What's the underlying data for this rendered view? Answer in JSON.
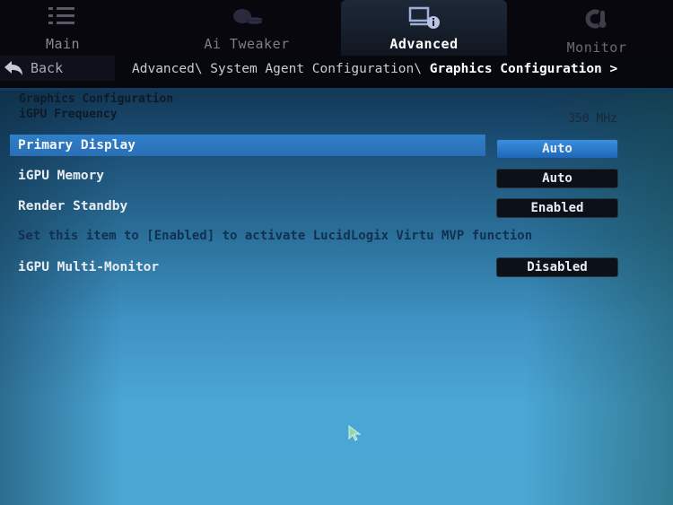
{
  "tabs": [
    {
      "label": "Main",
      "icon": "list-icon",
      "active": false
    },
    {
      "label": "Ai Tweaker",
      "icon": "tweaker-icon",
      "active": false
    },
    {
      "label": "Advanced",
      "icon": "advanced-info-icon",
      "active": true
    },
    {
      "label": "Monitor",
      "icon": "thermometer-icon",
      "active": false
    }
  ],
  "nav": {
    "back_label": "Back",
    "breadcrumb_path": "Advanced\\ System Agent Configuration\\ ",
    "breadcrumb_current": "Graphics Configuration >"
  },
  "section": {
    "title": "Graphics Configuration",
    "freq_label": "iGPU Frequency",
    "freq_value": "350 MHz"
  },
  "settings": [
    {
      "label": "Primary Display",
      "value": "Auto",
      "selected": true
    },
    {
      "label": "iGPU Memory",
      "value": "Auto",
      "selected": false
    },
    {
      "label": "Render Standby",
      "value": "Enabled",
      "selected": false
    },
    {
      "label": "iGPU Multi-Monitor",
      "value": "Disabled",
      "selected": false
    }
  ],
  "help_text": "Set this item to [Enabled] to activate LucidLogix Virtu MVP function",
  "colors": {
    "selected_row": "#2f7fc8",
    "value_button": "#0c1118",
    "background_top": "#123654",
    "background_bottom": "#4aa6d5"
  }
}
